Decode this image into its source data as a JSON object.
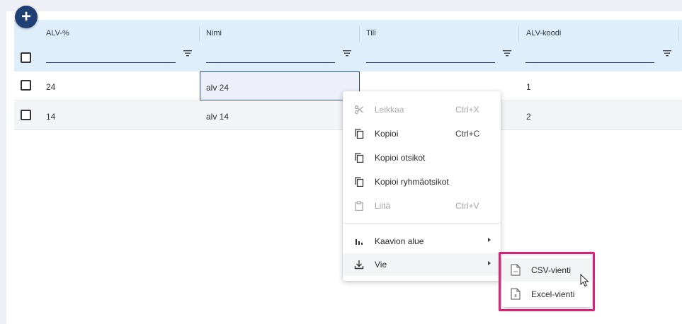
{
  "toolbar": {
    "add_label": "+"
  },
  "grid": {
    "columns": [
      {
        "title": "ALV-%"
      },
      {
        "title": "Nimi"
      },
      {
        "title": "Tili"
      },
      {
        "title": "ALV-koodi"
      }
    ],
    "rows": [
      {
        "alv_percent": "24",
        "nimi": "alv 24",
        "tili": "",
        "alv_koodi": "1"
      },
      {
        "alv_percent": "14",
        "nimi": "alv 14",
        "tili": "",
        "alv_koodi": "2"
      }
    ]
  },
  "context_menu": {
    "items": [
      {
        "label": "Leikkaa",
        "shortcut": "Ctrl+X",
        "icon": "scissors-icon",
        "disabled": true
      },
      {
        "label": "Kopioi",
        "shortcut": "Ctrl+C",
        "icon": "copy-icon",
        "disabled": false
      },
      {
        "label": "Kopioi otsikot",
        "shortcut": "",
        "icon": "copy-icon",
        "disabled": false
      },
      {
        "label": "Kopioi ryhmäotsikot",
        "shortcut": "",
        "icon": "copy-icon",
        "disabled": false
      },
      {
        "label": "Liitä",
        "shortcut": "Ctrl+V",
        "icon": "paste-icon",
        "disabled": true
      },
      {
        "label": "Kaavion alue",
        "shortcut": "",
        "icon": "bar-chart-icon",
        "disabled": false,
        "submenu": true
      },
      {
        "label": "Vie",
        "shortcut": "",
        "icon": "download-icon",
        "disabled": false,
        "submenu": true
      }
    ]
  },
  "export_submenu": {
    "items": [
      {
        "label": "CSV-vienti",
        "icon": "csv-file-icon"
      },
      {
        "label": "Excel-vienti",
        "icon": "excel-file-icon"
      }
    ]
  },
  "colors": {
    "accent": "#1f3f75",
    "header_bg": "#dfeefb",
    "highlight": "#d6237a"
  }
}
